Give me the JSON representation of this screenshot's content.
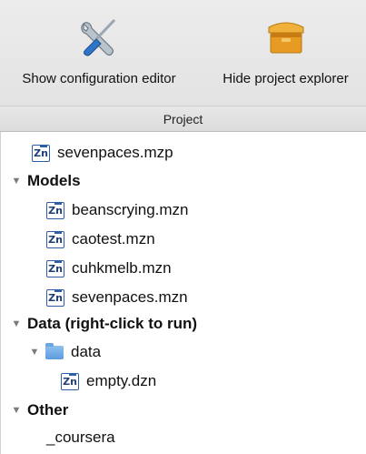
{
  "toolbar": {
    "config_label": "Show configuration editor",
    "hide_label": "Hide project explorer",
    "config_icon": "tools-icon",
    "hide_icon": "box-icon"
  },
  "header": {
    "title": "Project"
  },
  "tree": {
    "project_file": "sevenpaces.mzp",
    "models": {
      "label": "Models",
      "items": [
        "beanscrying.mzn",
        "caotest.mzn",
        "cuhkmelb.mzn",
        "sevenpaces.mzn"
      ]
    },
    "data": {
      "label": "Data (right-click to run)",
      "folder": "data",
      "items": [
        "empty.dzn"
      ]
    },
    "other": {
      "label": "Other",
      "items": [
        "_coursera"
      ]
    }
  },
  "colors": {
    "file_icon": "#2c5fa8",
    "folder": "#5a9bde"
  }
}
